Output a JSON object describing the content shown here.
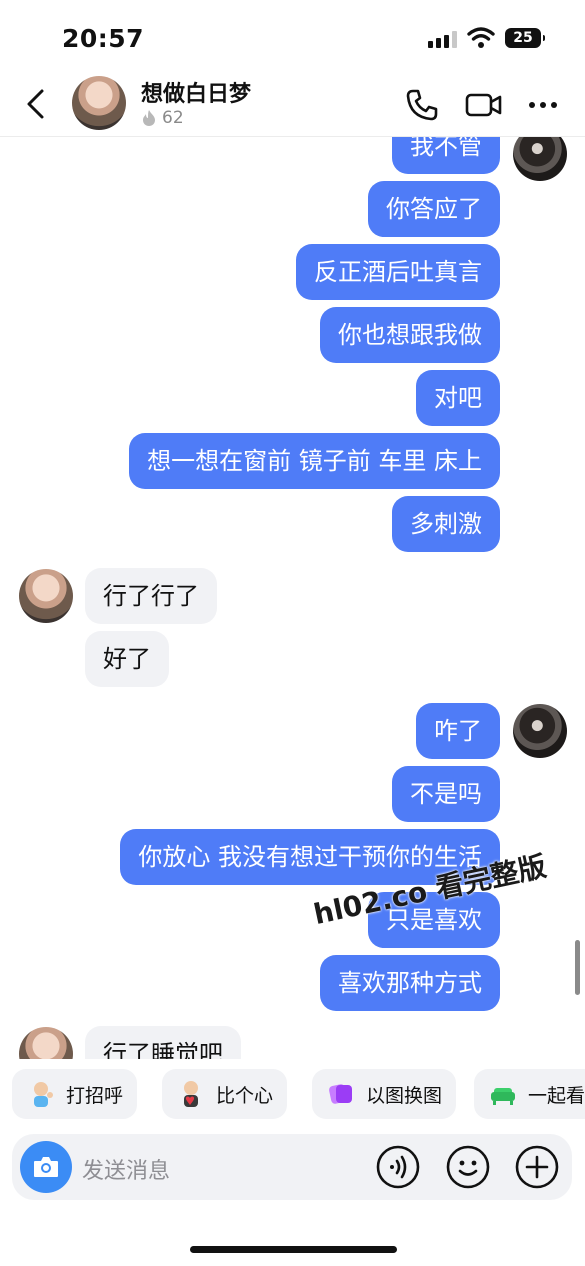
{
  "status_bar": {
    "time": "20:57",
    "battery": "25"
  },
  "header": {
    "contact_name": "想做白日梦",
    "flame_count": "62"
  },
  "messages": [
    {
      "side": "out",
      "text": "我不管"
    },
    {
      "side": "out",
      "text": "你答应了"
    },
    {
      "side": "out",
      "text": "反正酒后吐真言"
    },
    {
      "side": "out",
      "text": "你也想跟我做"
    },
    {
      "side": "out",
      "text": "对吧"
    },
    {
      "side": "out",
      "text": "想一想在窗前 镜子前 车里 床上"
    },
    {
      "side": "out",
      "text": "多刺激"
    },
    {
      "side": "in",
      "text": "行了行了"
    },
    {
      "side": "in",
      "text": "好了"
    },
    {
      "side": "out",
      "text": "咋了"
    },
    {
      "side": "out",
      "text": "不是吗"
    },
    {
      "side": "out",
      "text": "你放心 我没有想过干预你的生活"
    },
    {
      "side": "out",
      "text": "只是喜欢"
    },
    {
      "side": "out",
      "text": "喜欢那种方式"
    },
    {
      "side": "in",
      "text": "行了睡觉吧"
    }
  ],
  "watermark": "hl02.co 看完整版",
  "quick_replies": [
    {
      "label": "打招呼",
      "icon": "wave-sticker-icon"
    },
    {
      "label": "比个心",
      "icon": "heart-sticker-icon"
    },
    {
      "label": "以图换图",
      "icon": "photo-swap-icon"
    },
    {
      "label": "一起看",
      "icon": "sofa-icon"
    }
  ],
  "input": {
    "placeholder": "发送消息"
  },
  "colors": {
    "outgoing_bubble": "#4f7cf7",
    "incoming_bubble": "#f1f2f5",
    "camera_button": "#3b8cf5"
  }
}
